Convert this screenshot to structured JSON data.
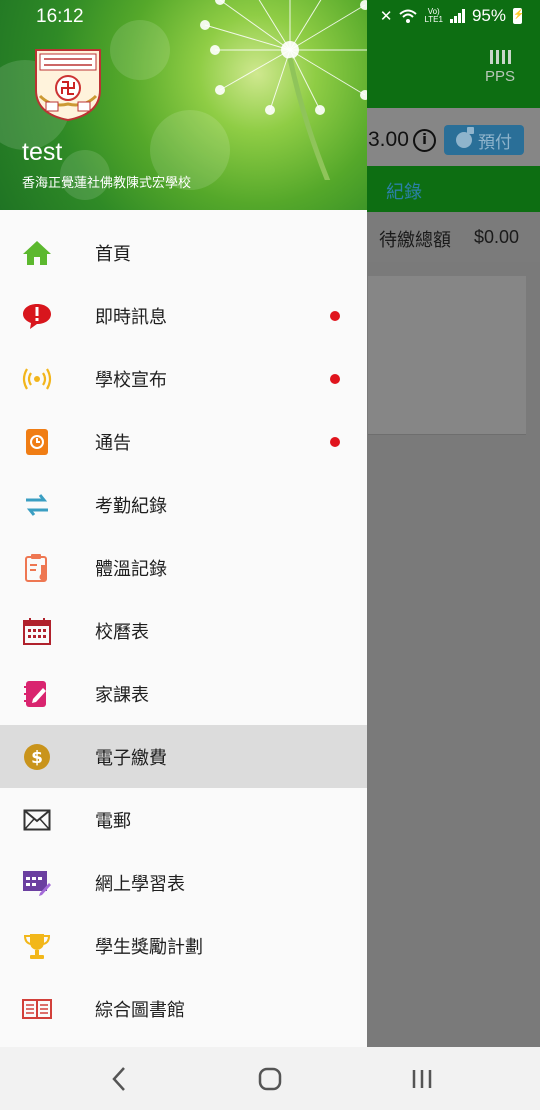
{
  "status_bar": {
    "time": "16:12",
    "network": "Vo)\nLTE1",
    "battery": "95%"
  },
  "background_app": {
    "pps_label": "PPS",
    "balance_amount": "3.00",
    "prepay_label": "預付",
    "record_tab": "紀錄",
    "due_label": "待繳總額",
    "due_value": "$0.00"
  },
  "drawer": {
    "user_name": "test",
    "school_name": "香海正覺蓮社佛教陳式宏學校",
    "menu": [
      {
        "label": "首頁",
        "icon": "home-icon",
        "badge": false,
        "active": false
      },
      {
        "label": "即時訊息",
        "icon": "chat-alert-icon",
        "badge": true,
        "active": false
      },
      {
        "label": "學校宣布",
        "icon": "broadcast-icon",
        "badge": true,
        "active": false
      },
      {
        "label": "通告",
        "icon": "notice-icon",
        "badge": true,
        "active": false
      },
      {
        "label": "考勤紀錄",
        "icon": "transfer-arrows-icon",
        "badge": false,
        "active": false
      },
      {
        "label": "體溫記錄",
        "icon": "thermometer-clipboard-icon",
        "badge": false,
        "active": false
      },
      {
        "label": "校曆表",
        "icon": "calendar-icon",
        "badge": false,
        "active": false
      },
      {
        "label": "家課表",
        "icon": "homework-notebook-icon",
        "badge": false,
        "active": false
      },
      {
        "label": "電子繳費",
        "icon": "dollar-coin-icon",
        "badge": false,
        "active": true
      },
      {
        "label": "電郵",
        "icon": "envelope-icon",
        "badge": false,
        "active": false
      },
      {
        "label": "網上學習表",
        "icon": "online-timetable-icon",
        "badge": false,
        "active": false
      },
      {
        "label": "學生獎勵計劃",
        "icon": "trophy-icon",
        "badge": false,
        "active": false
      },
      {
        "label": "綜合圖書館",
        "icon": "book-icon",
        "badge": false,
        "active": false
      }
    ]
  },
  "colors": {
    "header_green": "#2f8a26",
    "badge_red": "#e0141d",
    "active_row": "#dcdcdc",
    "app_bar_green": "#0d6e12"
  }
}
